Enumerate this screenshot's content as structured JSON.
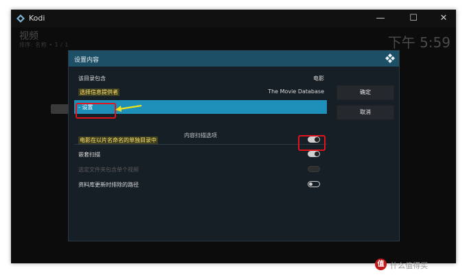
{
  "window": {
    "app_title": "Kodi",
    "minimize": "—",
    "maximize": "☐",
    "close": "✕"
  },
  "background": {
    "title": "视频",
    "subtitle": "排序: 名称 • 1 / 1",
    "clock": "下午 5:59"
  },
  "dialog": {
    "title": "设置内容",
    "rows": [
      {
        "label": "该目录包含",
        "value": "电影"
      },
      {
        "label": "选择信息提供者",
        "value": "The Movie Database"
      },
      {
        "label": "- 设置",
        "value": ""
      }
    ],
    "section_title": "内容扫描选项",
    "options": [
      {
        "label": "电影在以片名命名的单独目录中",
        "state": "on"
      },
      {
        "label": "嵌套扫描",
        "state": "on"
      },
      {
        "label": "选定文件夹包含单个视频",
        "state": "disabled"
      },
      {
        "label": "资料库更新时排除的路径",
        "state": "off"
      }
    ],
    "buttons": {
      "ok": "确定",
      "cancel": "取消"
    }
  },
  "watermark": {
    "logo_text": "值",
    "text": "什么值得买"
  },
  "colors": {
    "accent": "#1d8fb8",
    "header": "#1d4f66",
    "annotation": "#e0141c",
    "arrow": "#f2e21a"
  }
}
